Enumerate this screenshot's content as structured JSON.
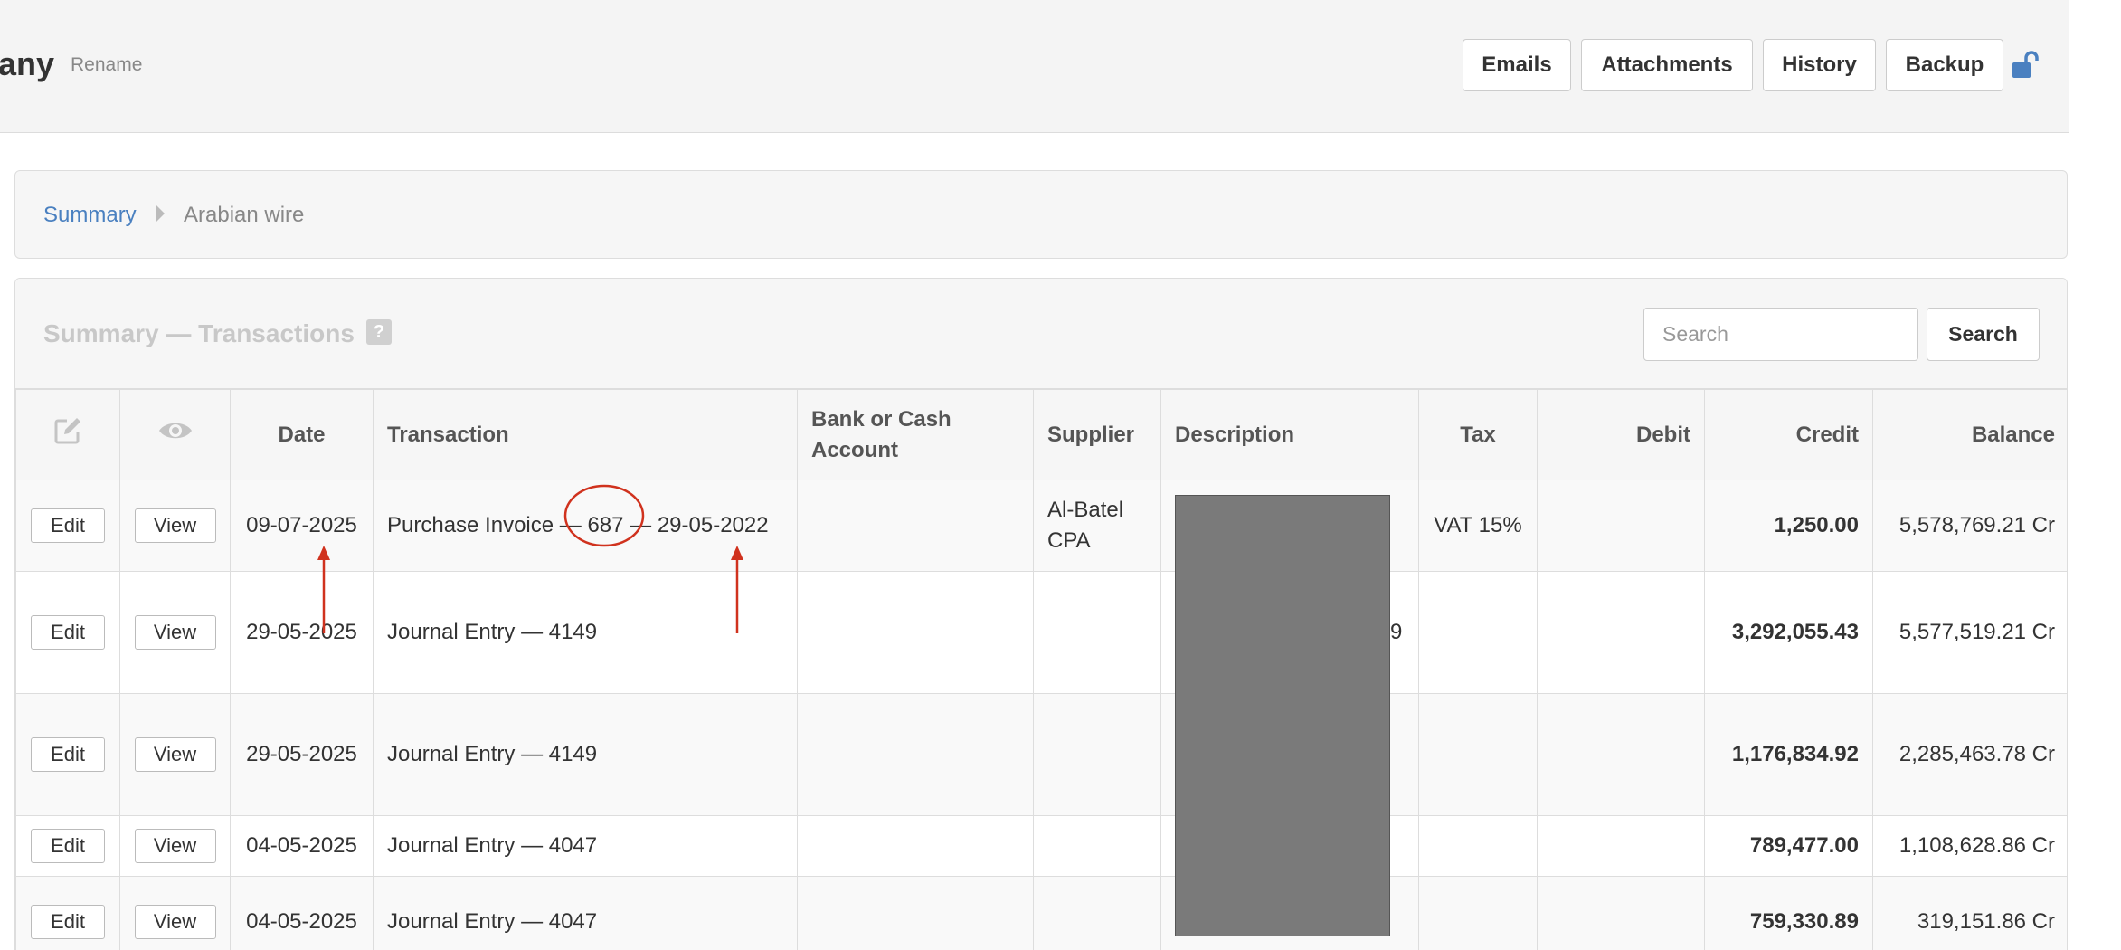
{
  "header": {
    "company_fragment": "any",
    "rename_label": "Rename",
    "buttons": [
      "Emails",
      "Attachments",
      "History",
      "Backup"
    ],
    "lock_icon": "unlock-icon",
    "lock_color": "#4a80c0"
  },
  "breadcrumb": {
    "root": "Summary",
    "current": "Arabian wire"
  },
  "panel": {
    "title": "Summary — Transactions",
    "help_label": "?",
    "search_placeholder": "Search",
    "search_button": "Search"
  },
  "table": {
    "columns": [
      "",
      "",
      "Date",
      "Transaction",
      "Bank or Cash Account",
      "Supplier",
      "Description",
      "Tax",
      "Debit",
      "Credit",
      "Balance"
    ],
    "edit_icon": "edit-icon",
    "view_icon": "eye-icon",
    "edit_label": "Edit",
    "view_label": "View",
    "rows": [
      {
        "date": "09-07-2025",
        "transaction": "Purchase Invoice — 687 — 29-05-2022",
        "bank": "",
        "supplier": "Al-Batel CPA",
        "description": "",
        "tax": "VAT 15%",
        "debit": "",
        "credit": "1,250.00",
        "balance": "5,578,769.21 Cr"
      },
      {
        "date": "29-05-2025",
        "transaction": "Journal Entry — 4149",
        "bank": "",
        "supplier": "",
        "description": "",
        "tax": "",
        "debit": "",
        "credit": "3,292,055.43",
        "balance": "5,577,519.21 Cr"
      },
      {
        "date": "29-05-2025",
        "transaction": "Journal Entry — 4149",
        "bank": "",
        "supplier": "",
        "description": "",
        "tax": "",
        "debit": "",
        "credit": "1,176,834.92",
        "balance": "2,285,463.78 Cr"
      },
      {
        "date": "04-05-2025",
        "transaction": "Journal Entry — 4047",
        "bank": "",
        "supplier": "",
        "description": "",
        "tax": "",
        "debit": "",
        "credit": "789,477.00",
        "balance": "1,108,628.86 Cr"
      },
      {
        "date": "04-05-2025",
        "transaction": "Journal Entry — 4047",
        "bank": "",
        "supplier": "",
        "description": "",
        "tax": "",
        "debit": "",
        "credit": "759,330.89",
        "balance": "319,151.86 Cr"
      }
    ]
  },
  "peek_text": {
    "row2_right": "9"
  },
  "annotation": {
    "color": "#d0321e"
  }
}
